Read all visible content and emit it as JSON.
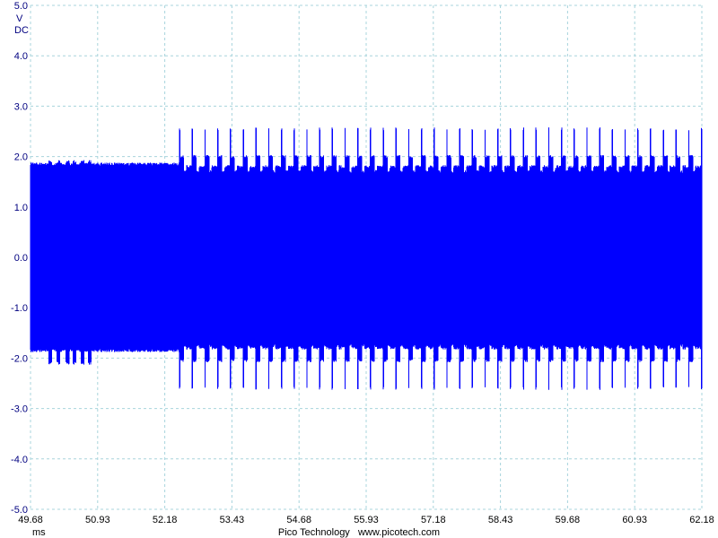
{
  "chart_data": {
    "type": "line",
    "title": "",
    "y_unit_lines": [
      "V",
      "DC"
    ],
    "x_unit": "ms",
    "footer": "Pico Technology   www.picotech.com",
    "xlim": [
      49.68,
      62.18
    ],
    "ylim": [
      -5.0,
      5.0
    ],
    "x_ticks": [
      "49.68",
      "50.93",
      "52.18",
      "53.43",
      "54.68",
      "55.93",
      "57.18",
      "58.43",
      "59.68",
      "60.93",
      "62.18"
    ],
    "y_ticks": [
      "5.0",
      "4.0",
      "3.0",
      "2.0",
      "1.0",
      "0.0",
      "-1.0",
      "-2.0",
      "-3.0",
      "-4.0",
      "-5.0"
    ],
    "grid": true,
    "trace_color": "#0000ff",
    "signal": {
      "description_free": true,
      "steady_envelope_v": [
        -1.85,
        1.85
      ],
      "initial_burst_window_ms": [
        49.68,
        51.0
      ],
      "initial_burst_gap_times_ms": [
        50.05,
        50.2,
        50.37,
        50.5,
        50.65,
        50.78
      ],
      "initial_burst_peak_v": [
        1.9,
        -2.1
      ],
      "quiet_window_ms": [
        51.0,
        52.45
      ],
      "pulsed_window_ms": [
        52.45,
        62.18
      ],
      "pulse_period_ms": 0.237,
      "pulse_peak_v": [
        2.55,
        -2.6
      ],
      "pulse_floor_v": [
        1.7,
        -1.75
      ]
    }
  }
}
